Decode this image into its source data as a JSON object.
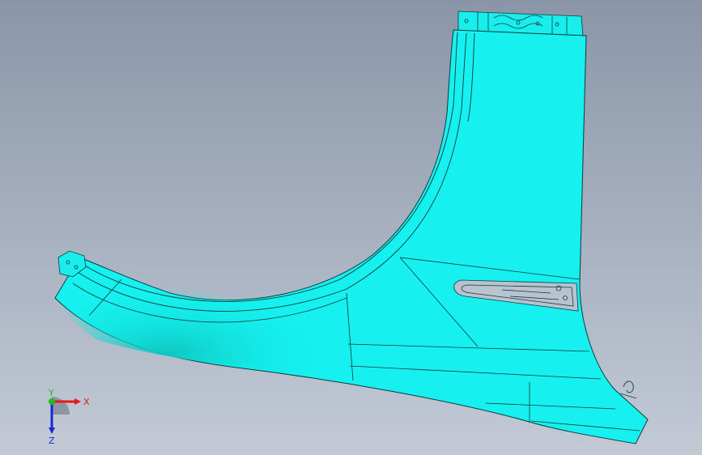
{
  "viewport": {
    "background_top": "#8a96a8",
    "background_bottom": "#c3cad6"
  },
  "model": {
    "part": "fender-panel",
    "fill_color": "#16f0ee",
    "shade_color": "#0fd4cf",
    "edge_color": "#0b3c3c"
  },
  "triad": {
    "x_label": "X",
    "y_label": "Y",
    "z_label": "Z",
    "x_color": "#e81818",
    "y_color": "#18c018",
    "z_color": "#1828d8"
  }
}
